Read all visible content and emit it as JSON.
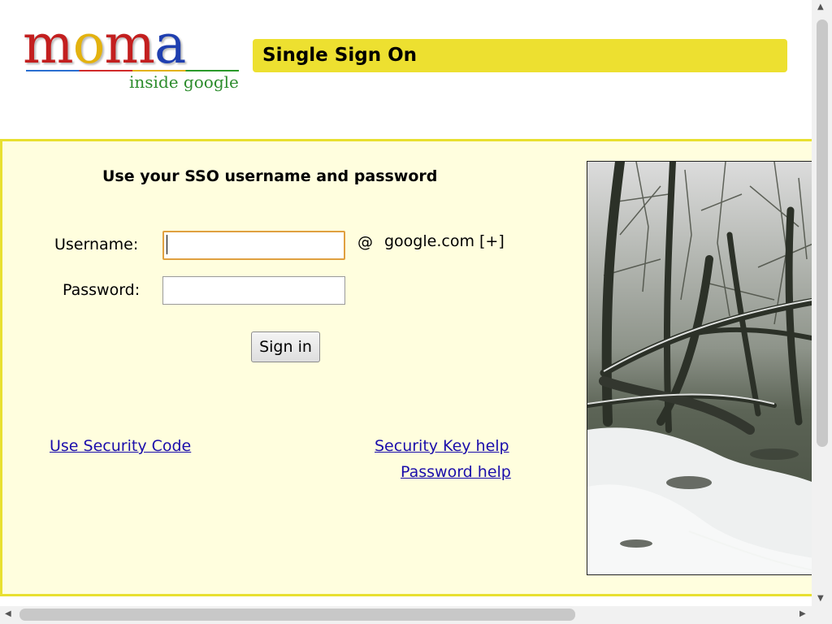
{
  "logo": {
    "letters": [
      "m",
      "o",
      "m",
      "a"
    ],
    "letter_colors": [
      "#c31f1f",
      "#e3b20f",
      "#c31f1f",
      "#1f3fb0"
    ],
    "subtitle": "inside google"
  },
  "header": {
    "title": "Single Sign On",
    "banner_color": "#ede030"
  },
  "login": {
    "heading": "Use your SSO username and password",
    "username_label": "Username:",
    "username_value": "",
    "at_sign": "@",
    "domain": "google.com [+]",
    "password_label": "Password:",
    "password_value": "",
    "sign_in_label": "Sign in"
  },
  "links": {
    "security_code": "Use Security Code",
    "security_key_help": "Security Key help",
    "password_help": "Password help"
  },
  "colors": {
    "panel_bg": "#fffede",
    "panel_border": "#e8e030",
    "link": "#1a0dab"
  }
}
